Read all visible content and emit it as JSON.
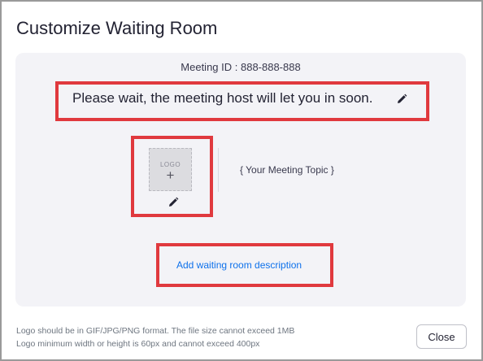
{
  "dialog": {
    "title": "Customize Waiting Room",
    "close_label": "Close"
  },
  "waiting_room": {
    "meeting_id": "Meeting ID : 888-888-888",
    "message": "Please wait, the meeting host will let you in soon.",
    "logo_placeholder": "LOGO",
    "logo_add": "+",
    "topic": "{ Your Meeting Topic }",
    "add_description": "Add waiting room description"
  },
  "footnotes": [
    "Logo should be in GIF/JPG/PNG format. The file size cannot exceed 1MB",
    "Logo minimum width or height is 60px and cannot exceed 400px"
  ],
  "icons": {
    "edit_message": "pencil-icon",
    "edit_logo": "pencil-icon"
  },
  "colors": {
    "highlight": "#e0393e",
    "link": "#0e71eb",
    "panel_bg": "#f3f3f7"
  }
}
